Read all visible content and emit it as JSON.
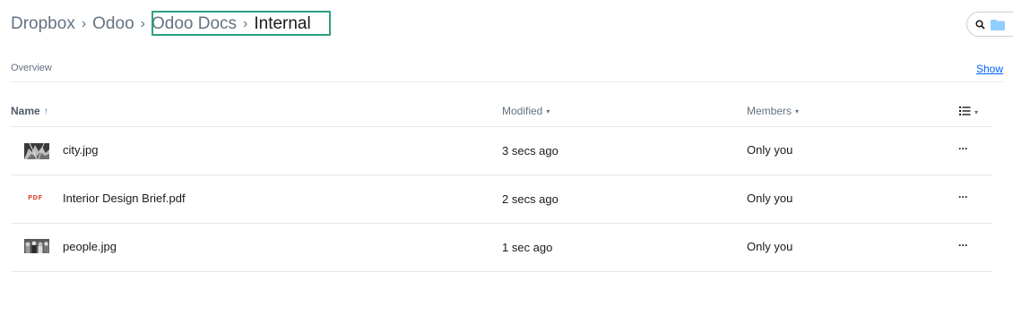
{
  "breadcrumb": {
    "items": [
      "Dropbox",
      "Odoo",
      "Odoo Docs",
      "Internal"
    ],
    "separator": "›"
  },
  "search": {
    "icon": "search-icon",
    "folder_icon": "folder-icon"
  },
  "overview": {
    "label": "Overview",
    "show_label": "Show"
  },
  "table": {
    "headers": {
      "name": "Name",
      "name_sort": "↑",
      "modified": "Modified",
      "members": "Members",
      "caret": "▾",
      "view_icon": "list-view-icon"
    },
    "rows": [
      {
        "name": "city.jpg",
        "modified": "3 secs ago",
        "members": "Only you",
        "icon": "image-thumbnail",
        "more": "···"
      },
      {
        "name": "Interior Design Brief.pdf",
        "modified": "2 secs ago",
        "members": "Only you",
        "icon": "pdf-icon",
        "icon_text": "PDF",
        "more": "···"
      },
      {
        "name": "people.jpg",
        "modified": "1 sec ago",
        "members": "Only you",
        "icon": "image-thumbnail",
        "more": "···"
      }
    ]
  },
  "colors": {
    "accent_link": "#0061fe",
    "highlight_box": "#2e9e82",
    "pdf_red": "#e04f3b",
    "folder_blue": "#92ceff"
  }
}
